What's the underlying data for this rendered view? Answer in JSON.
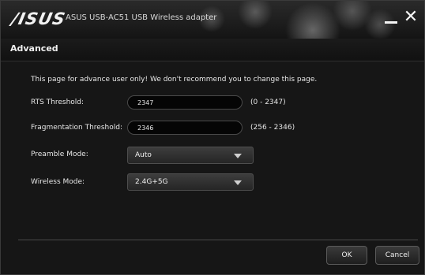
{
  "window": {
    "brand": "/ISUS",
    "title": "ASUS USB-AC51 USB Wireless adapter",
    "minimize_icon": "minimize-icon",
    "close_glyph": "✕"
  },
  "section": {
    "title": "Advanced"
  },
  "notice": "This page for advance user only! We don't recommend you to change this page.",
  "fields": {
    "rts": {
      "label": "RTS Threshold:",
      "value": "2347",
      "range": "(0 - 2347)"
    },
    "fragmentation": {
      "label": "Fragmentation Threshold:",
      "value": "2346",
      "range": "(256 - 2346)"
    },
    "preamble": {
      "label": "Preamble Mode:",
      "selected": "Auto"
    },
    "wireless": {
      "label": "Wireless Mode:",
      "selected": "2.4G+5G"
    }
  },
  "buttons": {
    "ok": "OK",
    "cancel": "Cancel"
  },
  "colors": {
    "background": "#161616",
    "text": "#e6e6e6",
    "input_bg": "#050505"
  }
}
